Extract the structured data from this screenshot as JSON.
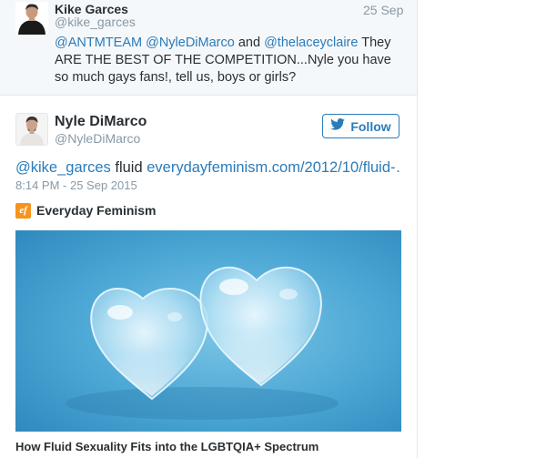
{
  "reply": {
    "name": "Kike Garces",
    "handle": "@kike_garces",
    "date": "25 Sep",
    "text_parts": {
      "m1": "@ANTMTEAM",
      "m2": "@NyleDiMarco",
      "and": " and ",
      "m3": "@thelaceyclaire",
      "body": " They ARE THE BEST OF THE COMPETITION...Nyle you have so much gays fans!, tell us, boys or girls?"
    }
  },
  "tweet": {
    "name": "Nyle DiMarco",
    "handle": "@NyleDiMarco",
    "follow_label": "Follow",
    "mention": "@kike_garces",
    "word": " fluid ",
    "link": "everydayfeminism.com/2012/10/fluid-…",
    "timestamp": "8:14 PM - 25 Sep 2015",
    "source_logo": "ef",
    "source_name": "Everyday Feminism",
    "card_title": "How Fluid Sexuality Fits into the LGBTQIA+ Spectrum"
  },
  "icons": {
    "follow": "twitter-bird-icon",
    "source": "everyday-feminism-logo-icon"
  },
  "colors": {
    "link": "#2b7bb9",
    "muted": "#8899a6",
    "reply_bg": "#f5f8fa",
    "source_logo": "#f7941d"
  }
}
